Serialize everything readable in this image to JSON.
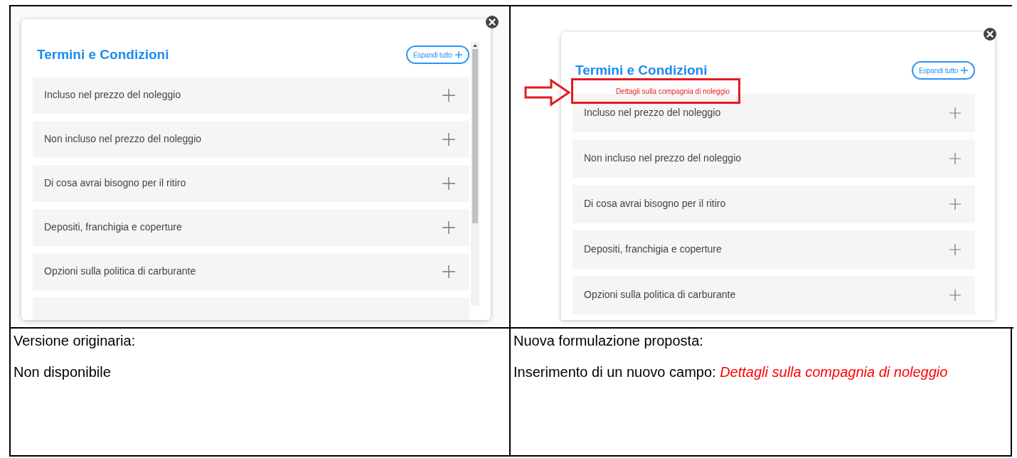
{
  "panels": [
    {
      "title": "Termini e Condizioni",
      "expand_button": "Espandi tutto",
      "sections": [
        "Incluso nel prezzo del noleggio",
        "Non incluso nel prezzo del noleggio",
        "Di cosa avrai bisogno per il ritiro",
        "Depositi, franchigia e coperture",
        "Opzioni sulla politica di carburante"
      ],
      "has_scrollbar": true
    },
    {
      "title": "Termini e Condizioni",
      "expand_button": "Espandi tutto",
      "annotation": "Dettagli sulla compagnia di noleggio",
      "sections": [
        "Incluso nel prezzo del noleggio",
        "Non incluso nel prezzo del noleggio",
        "Di cosa avrai bisogno per il ritiro",
        "Depositi, franchigia e coperture",
        "Opzioni sulla politica di carburante"
      ],
      "has_scrollbar": false
    }
  ],
  "notes": [
    {
      "heading": "Versione originaria:",
      "body": "Non disponibile"
    },
    {
      "heading": "Nuova formulazione proposta:",
      "body": "Inserimento di un nuovo campo: ",
      "highlight": "Dettagli sulla compagnia di noleggio"
    }
  ]
}
